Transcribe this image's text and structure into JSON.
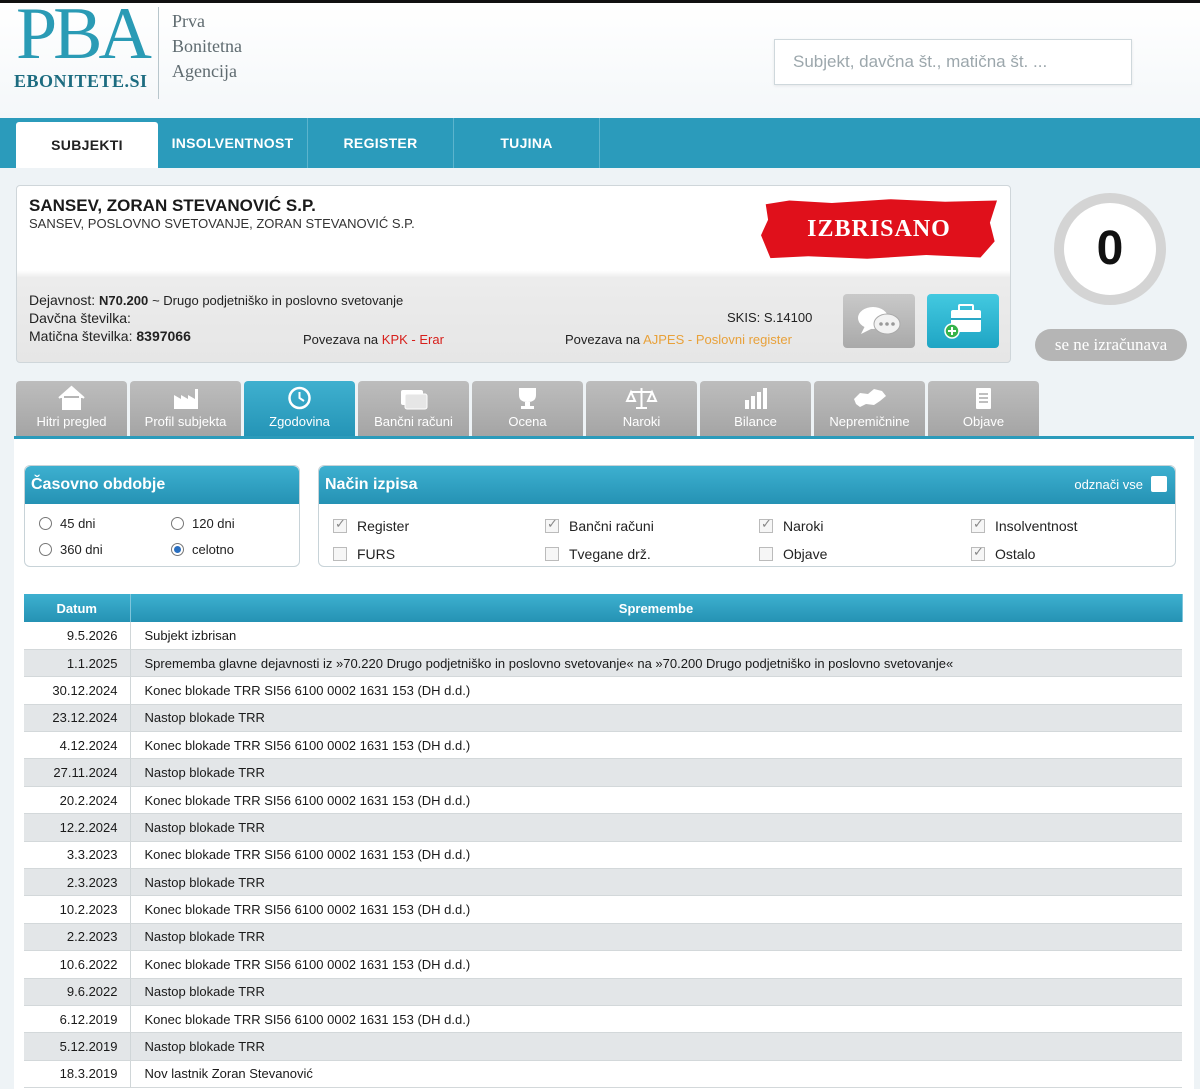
{
  "header": {
    "logo_big": "PBA",
    "logo_sub": "EBONITETE.SI",
    "agency": [
      "Prva",
      "Bonitetna",
      "Agencija"
    ],
    "search_placeholder": "Subjekt, davčna št., matična št. ..."
  },
  "nav": {
    "tabs": [
      "SUBJEKTI",
      "INSOLVENTNOST",
      "REGISTER",
      "TUJINA"
    ],
    "active": "SUBJEKTI"
  },
  "subject": {
    "name": "SANSEV, ZORAN STEVANOVIĆ S.P.",
    "full_name": "SANSEV, POSLOVNO SVETOVANJE, ZORAN STEVANOVIĆ S.P.",
    "stamp": "IZBRISANO",
    "dejavnost_label": "Dejavnost:",
    "dejavnost_code": "N70.200",
    "dejavnost_desc": "~ Drugo podjetniško in poslovno svetovanje",
    "davcna_label": "Davčna številka:",
    "maticna_label": "Matična številka:",
    "maticna_value": "8397066",
    "skis_label": "SKIS:",
    "skis_value": "S.14100",
    "link1_prefix": "Povezava na",
    "link1": "KPK - Erar",
    "link2_prefix": "Povezava na",
    "link2": "AJPES - Poslovni register"
  },
  "score": {
    "value": "0",
    "status": "se ne izračunava"
  },
  "feature_tabs": [
    {
      "label": "Hitri pregled",
      "icon": "home-icon"
    },
    {
      "label": "Profil subjekta",
      "icon": "factory-icon"
    },
    {
      "label": "Zgodovina",
      "icon": "clock-icon"
    },
    {
      "label": "Bančni računi",
      "icon": "card-icon"
    },
    {
      "label": "Ocena",
      "icon": "trophy-icon"
    },
    {
      "label": "Naroki",
      "icon": "scales-icon"
    },
    {
      "label": "Bilance",
      "icon": "bar-chart-icon"
    },
    {
      "label": "Nepremičnine",
      "icon": "slovenia-map-icon"
    },
    {
      "label": "Objave",
      "icon": "notepad-icon"
    }
  ],
  "active_feature_tab": "Zgodovina",
  "period": {
    "title": "Časovno obdobje",
    "options": [
      {
        "label": "45 dni",
        "checked": false
      },
      {
        "label": "120 dni",
        "checked": false
      },
      {
        "label": "360 dni",
        "checked": false
      },
      {
        "label": "celotno",
        "checked": true
      }
    ]
  },
  "mode": {
    "title": "Način izpisa",
    "deselect_all": "odznači vse",
    "options": [
      {
        "label": "Register",
        "checked": true
      },
      {
        "label": "Bančni računi",
        "checked": true
      },
      {
        "label": "Naroki",
        "checked": true
      },
      {
        "label": "Insolventnost",
        "checked": true
      },
      {
        "label": "FURS",
        "checked": false
      },
      {
        "label": "Tvegane drž.",
        "checked": false
      },
      {
        "label": "Objave",
        "checked": false
      },
      {
        "label": "Ostalo",
        "checked": true
      }
    ]
  },
  "table": {
    "headers": [
      "Datum",
      "Spremembe"
    ],
    "rows": [
      {
        "date": "9.5.2026",
        "change": "Subjekt izbrisan"
      },
      {
        "date": "1.1.2025",
        "change": "Sprememba glavne dejavnosti iz »70.220 Drugo podjetniško in poslovno svetovanje« na »70.200 Drugo podjetniško in poslovno svetovanje«"
      },
      {
        "date": "30.12.2024",
        "change": "Konec blokade TRR SI56 6100 0002 1631 153 (DH d.d.)"
      },
      {
        "date": "23.12.2024",
        "change": "Nastop blokade TRR"
      },
      {
        "date": "4.12.2024",
        "change": "Konec blokade TRR SI56 6100 0002 1631 153 (DH d.d.)"
      },
      {
        "date": "27.11.2024",
        "change": "Nastop blokade TRR"
      },
      {
        "date": "20.2.2024",
        "change": "Konec blokade TRR SI56 6100 0002 1631 153 (DH d.d.)"
      },
      {
        "date": "12.2.2024",
        "change": "Nastop blokade TRR"
      },
      {
        "date": "3.3.2023",
        "change": "Konec blokade TRR SI56 6100 0002 1631 153 (DH d.d.)"
      },
      {
        "date": "2.3.2023",
        "change": "Nastop blokade TRR"
      },
      {
        "date": "10.2.2023",
        "change": "Konec blokade TRR SI56 6100 0002 1631 153 (DH d.d.)"
      },
      {
        "date": "2.2.2023",
        "change": "Nastop blokade TRR"
      },
      {
        "date": "10.6.2022",
        "change": "Konec blokade TRR SI56 6100 0002 1631 153 (DH d.d.)"
      },
      {
        "date": "9.6.2022",
        "change": "Nastop blokade TRR"
      },
      {
        "date": "6.12.2019",
        "change": "Konec blokade TRR SI56 6100 0002 1631 153 (DH d.d.)"
      },
      {
        "date": "5.12.2019",
        "change": "Nastop blokade TRR"
      },
      {
        "date": "18.3.2019",
        "change": "Nov lastnik Zoran Stevanović"
      }
    ]
  },
  "colors": {
    "accent": "#2b9bbb",
    "stamp": "#e0101b",
    "link_red": "#d7201c",
    "link_orange": "#e8a13a"
  }
}
